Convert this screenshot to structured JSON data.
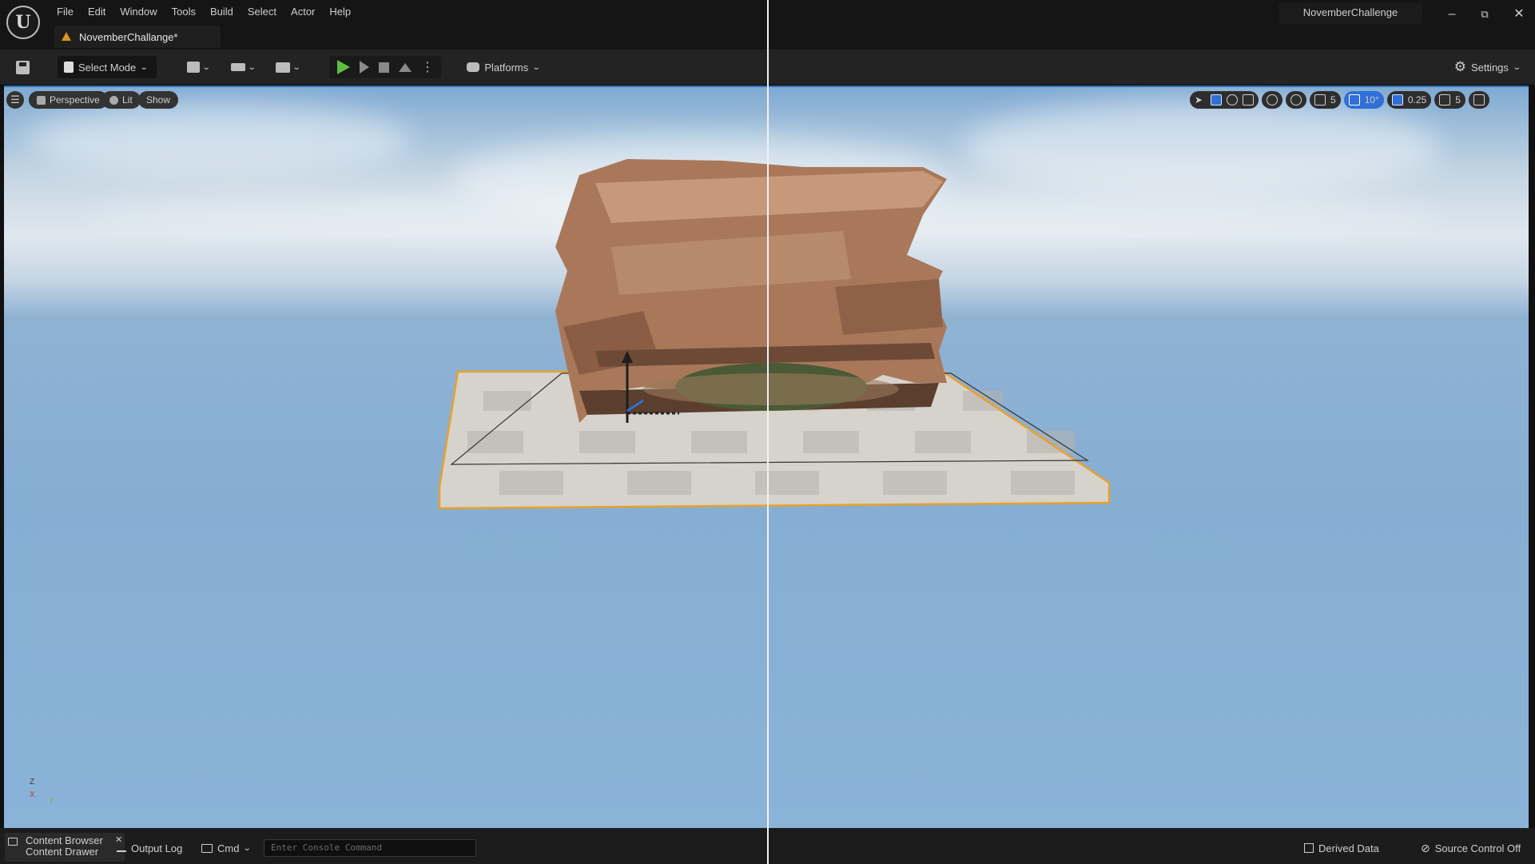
{
  "app": {
    "project_name": "NovemberChallenge",
    "document_tab": "NovemberChallange*"
  },
  "menu": [
    "File",
    "Edit",
    "Window",
    "Tools",
    "Build",
    "Select",
    "Actor",
    "Help"
  ],
  "toolbar": {
    "select_mode_label": "Select Mode",
    "platforms_label": "Platforms",
    "settings_label": "Settings"
  },
  "viewport": {
    "perspective_label": "Perspective",
    "lit_label": "Lit",
    "show_label": "Show",
    "grid_snap_value": "5",
    "rotation_snap_value": "10°",
    "scale_snap_value": "0.25",
    "camera_speed_value": "5",
    "axis_z": "Z",
    "axis_x": "X",
    "axis_y": "Y"
  },
  "statusbar": {
    "content_browser_label": "Content Browser",
    "content_drawer_label": "Content Drawer",
    "output_log_label": "Output Log",
    "cmd_label": "Cmd",
    "console_placeholder": "Enter Console Command",
    "derived_data_label": "Derived Data",
    "source_control_label": "Source Control Off"
  },
  "colors": {
    "accent_blue": "#2f6fd6",
    "play_green": "#5fbf3a",
    "selection_orange": "#e8a12a",
    "sky": "#86aed3"
  }
}
